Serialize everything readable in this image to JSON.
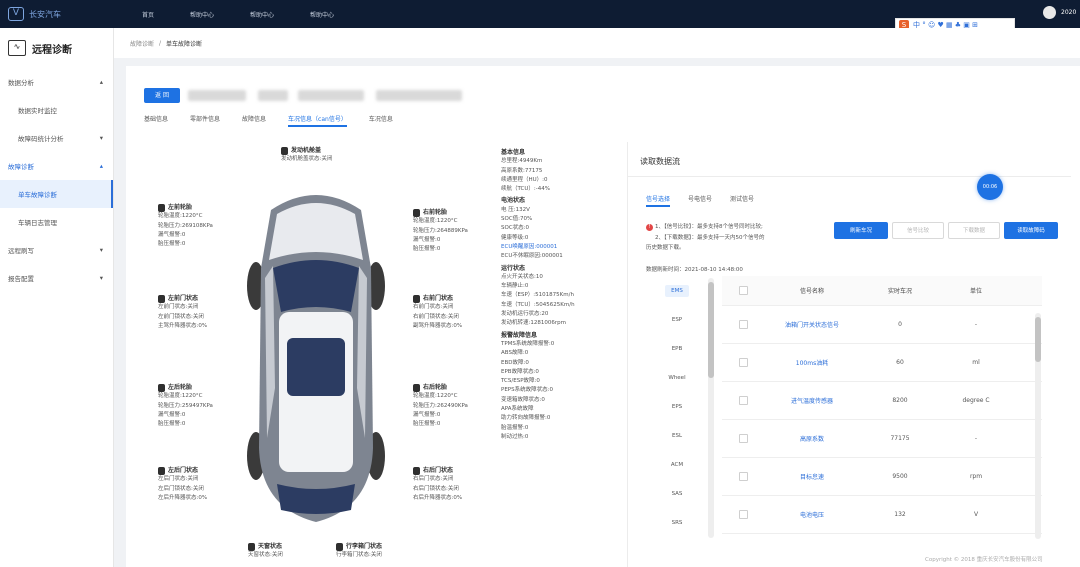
{
  "topbar": {
    "brand": "长安汽车",
    "nav": [
      "首页",
      "帮助中心",
      "帮助中心",
      "帮助中心"
    ],
    "user_label": "2020",
    "ime_letter": "S",
    "ime_text": "中 ° ☺ ♥ ▦ ♣ ▣ ⊞"
  },
  "sidebar": {
    "app_title": "远程诊断",
    "items": [
      {
        "label": "数据分析",
        "arrow": "▴"
      },
      {
        "label": "数据实时监控",
        "arrow": ""
      },
      {
        "label": "故障码统计分析",
        "arrow": "▾"
      },
      {
        "label": "故障诊断",
        "arrow": "▴"
      },
      {
        "label": "单车故障诊断",
        "arrow": ""
      },
      {
        "label": "车辆日志管理",
        "arrow": ""
      },
      {
        "label": "远程刷写",
        "arrow": "▾"
      },
      {
        "label": "报告配置",
        "arrow": "▾"
      }
    ]
  },
  "breadcrumb": {
    "parent": "故障诊断",
    "sep": "/",
    "current": "单车故障诊断"
  },
  "vin_button": "返 回",
  "tabs": [
    "基础信息",
    "零部件信息",
    "故障信息",
    "车况信息（can信号）",
    "车况信息"
  ],
  "car": {
    "engine": {
      "title": "发动机舱盖",
      "line": "发动机舱盖状态:关闭"
    },
    "left_front_wheel": {
      "title": "左前轮胎",
      "lines": [
        "轮胎温度:1220°C",
        "轮胎压力:269108KPa",
        "漏气报警:0",
        "胎压报警:0"
      ]
    },
    "right_front_wheel": {
      "title": "右前轮胎",
      "lines": [
        "轮胎温度:1220°C",
        "轮胎压力:264889KPa",
        "漏气报警:0",
        "胎压报警:0"
      ]
    },
    "left_front_door": {
      "title": "左前门状态",
      "lines": [
        "左前门状态:关闭",
        "左前门锁状态:关闭",
        "主驾升降器状态:0%"
      ]
    },
    "right_front_door": {
      "title": "右前门状态",
      "lines": [
        "右前门状态:关闭",
        "右前门锁状态:关闭",
        "副驾升降器状态:0%"
      ]
    },
    "left_rear_wheel": {
      "title": "左后轮胎",
      "lines": [
        "轮胎温度:1220°C",
        "轮胎压力:259497KPa",
        "漏气报警:0",
        "胎压报警:0"
      ]
    },
    "right_rear_wheel": {
      "title": "右后轮胎",
      "lines": [
        "轮胎温度:1220°C",
        "轮胎压力:262490KPa",
        "漏气报警:0",
        "胎压报警:0"
      ]
    },
    "left_rear_door": {
      "title": "左后门状态",
      "lines": [
        "左后门状态:关闭",
        "左后门锁状态:关闭",
        "左后升降器状态:0%"
      ]
    },
    "right_rear_door": {
      "title": "右后门状态",
      "lines": [
        "右后门状态:关闭",
        "右后门锁状态:关闭",
        "右后升降器状态:0%"
      ]
    },
    "sunroof": {
      "title": "天窗状态",
      "line": "天窗状态:关闭"
    },
    "trunk": {
      "title": "行李箱门状态",
      "line": "行李箱门状态:关闭"
    }
  },
  "info": {
    "basic_title": "基本信息",
    "basic": [
      "总里程:4949Km",
      "高原系数:77175",
      "续通里程（HU）:0",
      "续航（TCU）:-44%"
    ],
    "battery_title": "电池状态",
    "battery": [
      "电 压:132V",
      "SOC值:70%",
      "SOC状态:0",
      "健康等级:0"
    ],
    "battery_link": "ECU唤醒原因:000001",
    "battery_extra": "ECU不休眠原因:000001",
    "run_title": "运行状态",
    "run": [
      "点火开关状态:10",
      "车辆静止:0",
      "车速（ESP）:5101875Km/h",
      "车速（TCU）:5045625Km/h",
      "发动机运行状态:20",
      "发动机转速:1281006rpm"
    ],
    "alarm_title": "报警故障信息",
    "alarm": [
      "TPMS系统故障报警:0",
      "ABS故障:0",
      "EBD故障:0",
      "EPB故障状态:0",
      "TCS/ESP故障:0",
      "PEPS系统故障状态:0",
      "变速箱故障状态:0",
      "APA系统故障",
      "助力转向故障报警:0",
      "胎温报警:0",
      "制动过热:0"
    ]
  },
  "right": {
    "title": "读取数据流",
    "badge": "00:06",
    "tabs": [
      "信号选择",
      "号电信号",
      "测试信号"
    ],
    "notes": [
      "1、【信号比较】：最多支持8个信号同时比较;",
      "2、【下载数据】：最多支持一天内50个信号的",
      "历史数据下载。"
    ],
    "refresh_time": "数据刷新时间：2021-08-10 14:48:00",
    "buttons": [
      "刷新车况",
      "信号比较",
      "下载数据",
      "读取故障码"
    ],
    "systems": [
      "EMS",
      "ESP",
      "EPB",
      "Wheel",
      "EPS",
      "ESL",
      "ACM",
      "SAS",
      "SRS"
    ],
    "columns": [
      "信号名称",
      "实时车况",
      "单位"
    ],
    "rows": [
      {
        "name": "油箱门开关状态信号",
        "value": "0",
        "unit": "-"
      },
      {
        "name": "100ms油耗",
        "value": "60",
        "unit": "ml"
      },
      {
        "name": "进气温度传感器",
        "value": "8200",
        "unit": "degree C"
      },
      {
        "name": "高原系数",
        "value": "77175",
        "unit": "-"
      },
      {
        "name": "目标怠速",
        "value": "9500",
        "unit": "rpm"
      },
      {
        "name": "电池电压",
        "value": "132",
        "unit": "V"
      }
    ],
    "copyright": "Copyright © 2018 重庆长安汽车股份有限公司"
  }
}
